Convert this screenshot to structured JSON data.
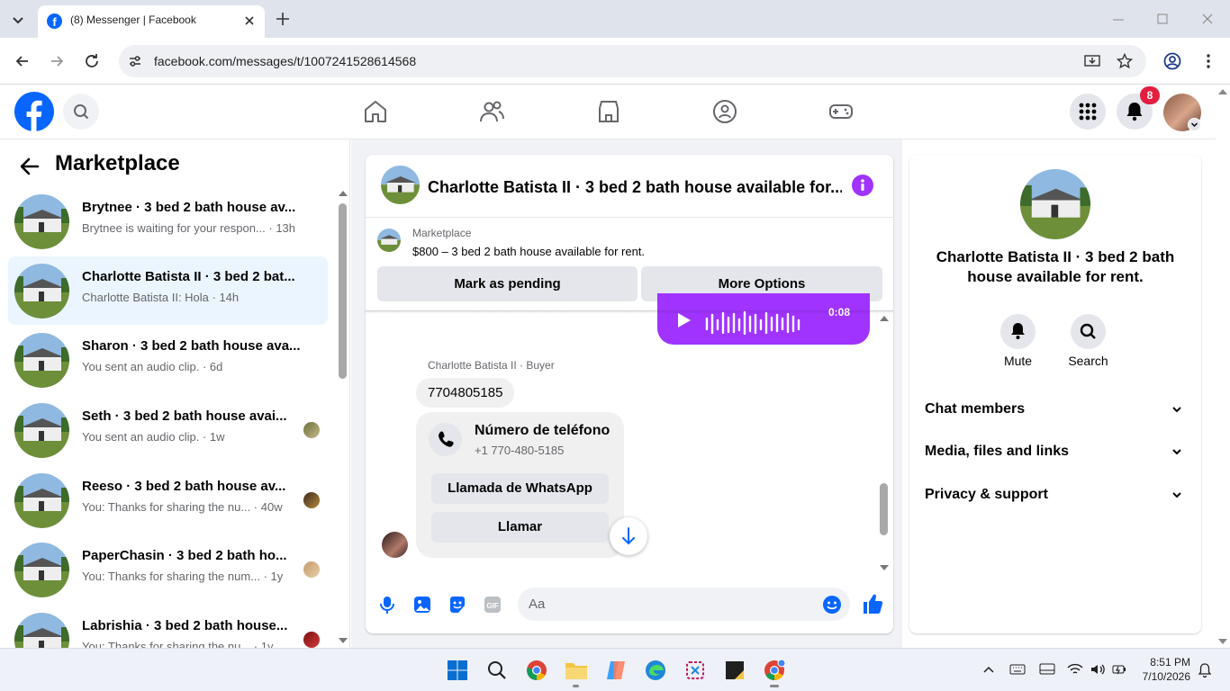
{
  "browser": {
    "tab_title": "(8) Messenger | Facebook",
    "url": "facebook.com/messages/t/1007241528614568"
  },
  "fb_header": {
    "notification_count": "8"
  },
  "left": {
    "title": "Marketplace",
    "conversations": [
      {
        "name": "Brytnee · 3 bed 2 bath house av...",
        "preview": "Brytnee is waiting for your respon... · 13h",
        "selected": false
      },
      {
        "name": "Charlotte Batista II · 3 bed 2 bat...",
        "preview": "Charlotte Batista II: Hola · 14h",
        "selected": true
      },
      {
        "name": "Sharon · 3 bed 2 bath house ava...",
        "preview": "You sent an audio clip. · 6d",
        "selected": false
      },
      {
        "name": "Seth · 3 bed 2 bath house avai...",
        "preview": "You sent an audio clip. · 1w",
        "selected": false
      },
      {
        "name": "Reeso · 3 bed 2 bath house av...",
        "preview": "You: Thanks for sharing the nu... · 40w",
        "selected": false
      },
      {
        "name": "PaperChasin · 3 bed 2 bath ho...",
        "preview": "You: Thanks for sharing the num... · 1y",
        "selected": false
      },
      {
        "name": "Labrishia · 3 bed 2 bath house...",
        "preview": "You: Thanks for sharing the nu... · 1y",
        "selected": false
      }
    ]
  },
  "chat": {
    "title": "Charlotte Batista II · 3 bed 2 bath house available for...",
    "listing_label": "Marketplace",
    "listing_text": "$800 – 3 bed 2 bath house available for rent.",
    "mark_pending": "Mark as pending",
    "more_options": "More Options",
    "audio_time": "0:08",
    "sender_label": "Charlotte Batista II · Buyer",
    "phone_message": "7704805185",
    "card_title": "Número de teléfono",
    "card_number": "+1 770-480-5185",
    "whatsapp_button": "Llamada de WhatsApp",
    "call_button": "Llamar",
    "input_placeholder": "Aa"
  },
  "right": {
    "title": "Charlotte Batista II · 3 bed 2 bath house available for rent.",
    "mute_label": "Mute",
    "search_label": "Search",
    "sections": [
      "Chat members",
      "Media, files and links",
      "Privacy & support"
    ]
  },
  "taskbar": {
    "time": "8:51 PM",
    "date": "7/10/2026"
  },
  "colors": {
    "fb_blue": "#0866ff",
    "messenger_purple": "#a033ff",
    "selected_bg": "#ebf5ff",
    "badge_red": "#e41e3f"
  }
}
